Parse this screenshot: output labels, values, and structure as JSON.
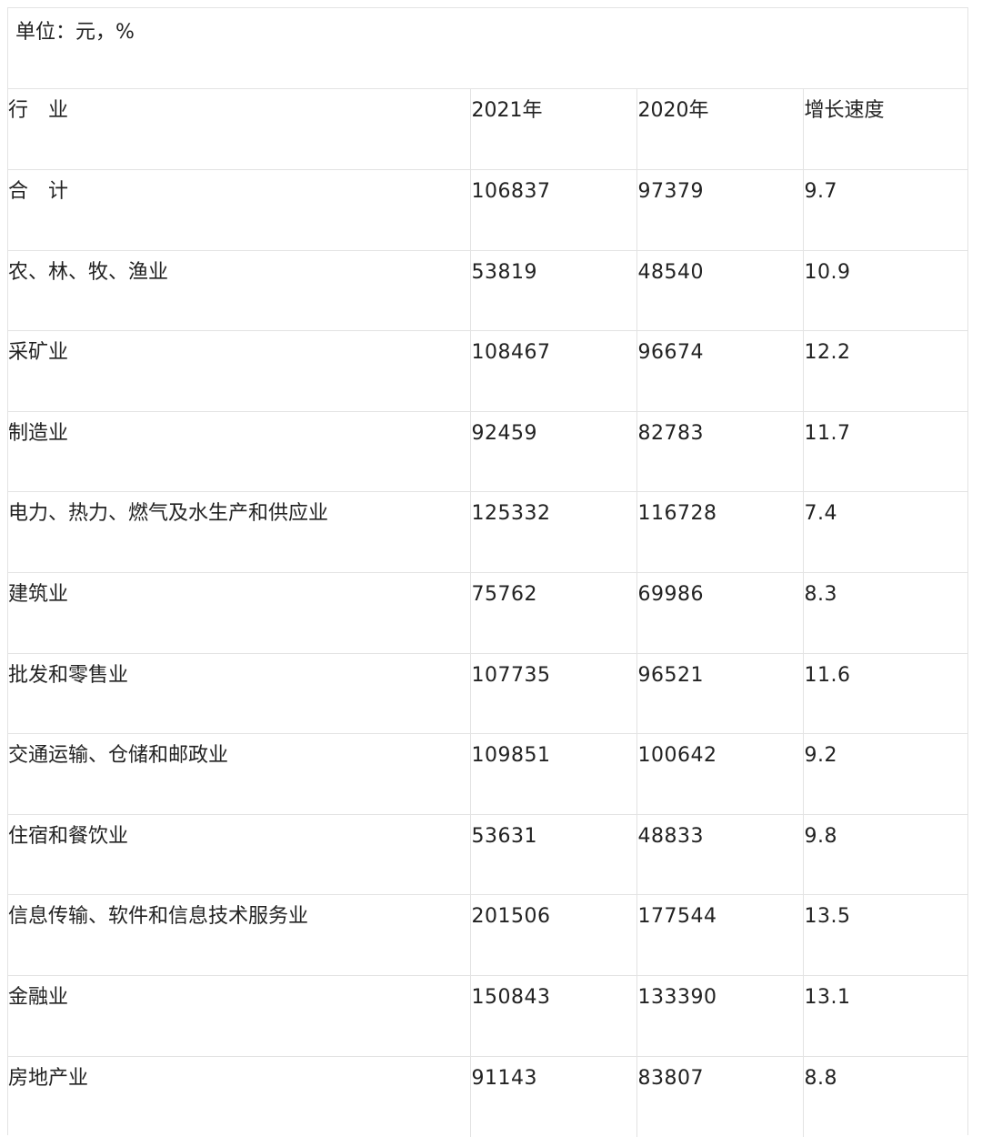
{
  "table": {
    "unit": "单位：元，%",
    "headers": [
      "行　业",
      "2021年",
      "2020年",
      "增长速度"
    ],
    "rows": [
      [
        "合　计",
        "106837",
        "97379",
        "9.7"
      ],
      [
        "农、林、牧、渔业",
        "53819",
        "48540",
        "10.9"
      ],
      [
        "采矿业",
        "108467",
        "96674",
        "12.2"
      ],
      [
        "制造业",
        "92459",
        "82783",
        "11.7"
      ],
      [
        "电力、热力、燃气及水生产和供应业",
        "125332",
        "116728",
        "7.4"
      ],
      [
        "建筑业",
        "75762",
        "69986",
        "8.3"
      ],
      [
        "批发和零售业",
        "107735",
        "96521",
        "11.6"
      ],
      [
        "交通运输、仓储和邮政业",
        "109851",
        "100642",
        "9.2"
      ],
      [
        "住宿和餐饮业",
        "53631",
        "48833",
        "9.8"
      ],
      [
        "信息传输、软件和信息技术服务业",
        "201506",
        "177544",
        "13.5"
      ],
      [
        "金融业",
        "150843",
        "133390",
        "13.1"
      ],
      [
        "房地产业",
        "91143",
        "83807",
        "8.8"
      ]
    ]
  }
}
